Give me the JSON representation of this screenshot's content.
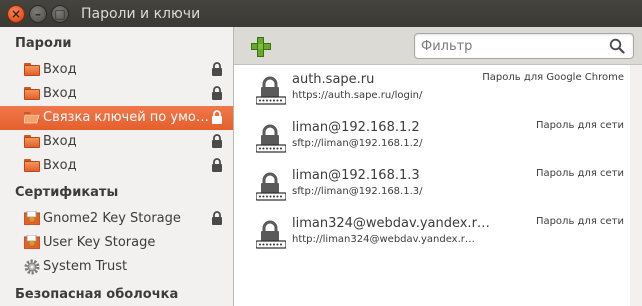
{
  "window": {
    "title": "Пароли и ключи",
    "buttons": {
      "close": "×",
      "minimize": "–",
      "maximize": "□"
    }
  },
  "sidebar": {
    "sections": [
      {
        "heading": "Пароли"
      },
      {
        "heading": "Сертификаты"
      },
      {
        "heading": "Безопасная оболочка"
      }
    ],
    "passwords": [
      {
        "label": "Вход",
        "icon": "folder-icon",
        "locked": true,
        "selected": false
      },
      {
        "label": "Вход",
        "icon": "folder-icon",
        "locked": true,
        "selected": false
      },
      {
        "label": "Связка ключей по умо…",
        "icon": "folder-open-icon",
        "locked": true,
        "selected": true
      },
      {
        "label": "Вход",
        "icon": "folder-icon",
        "locked": true,
        "selected": false
      },
      {
        "label": "Вход",
        "icon": "folder-icon",
        "locked": true,
        "selected": false
      }
    ],
    "certificates": [
      {
        "label": "Gnome2 Key Storage",
        "icon": "certificate-folder-icon",
        "locked": true
      },
      {
        "label": "User Key Storage",
        "icon": "certificate-folder-icon",
        "locked": false
      },
      {
        "label": "System Trust",
        "icon": "gear-icon",
        "locked": false
      }
    ]
  },
  "toolbar": {
    "add_icon": "plus-icon",
    "filter_placeholder": "Фильтр",
    "search_icon": "search-icon"
  },
  "entries": [
    {
      "title": "auth.sape.ru",
      "subtitle": "https://auth.sape.ru/login/",
      "type": "Пароль для Google Chrome",
      "icon": "lock-key-icon"
    },
    {
      "title": "liman@192.168.1.2",
      "subtitle": "sftp://liman@192.168.1.2/",
      "type": "Пароль для сети",
      "icon": "lock-key-icon"
    },
    {
      "title": "liman@192.168.1.3",
      "subtitle": "sftp://liman@192.168.1.3/",
      "type": "Пароль для сети",
      "icon": "lock-key-icon"
    },
    {
      "title": "liman324@webdav.yandex.r…",
      "subtitle": "http://liman324@webdav.yandex.r…",
      "type": "Пароль для сети",
      "icon": "lock-key-icon"
    }
  ],
  "colors": {
    "selection": "#e55f2d",
    "titlebar": "#3c3b37",
    "sidebar_bg": "#f2f1f0",
    "toolbar_bg": "#dcdad5",
    "add_green": "#68a82e"
  }
}
